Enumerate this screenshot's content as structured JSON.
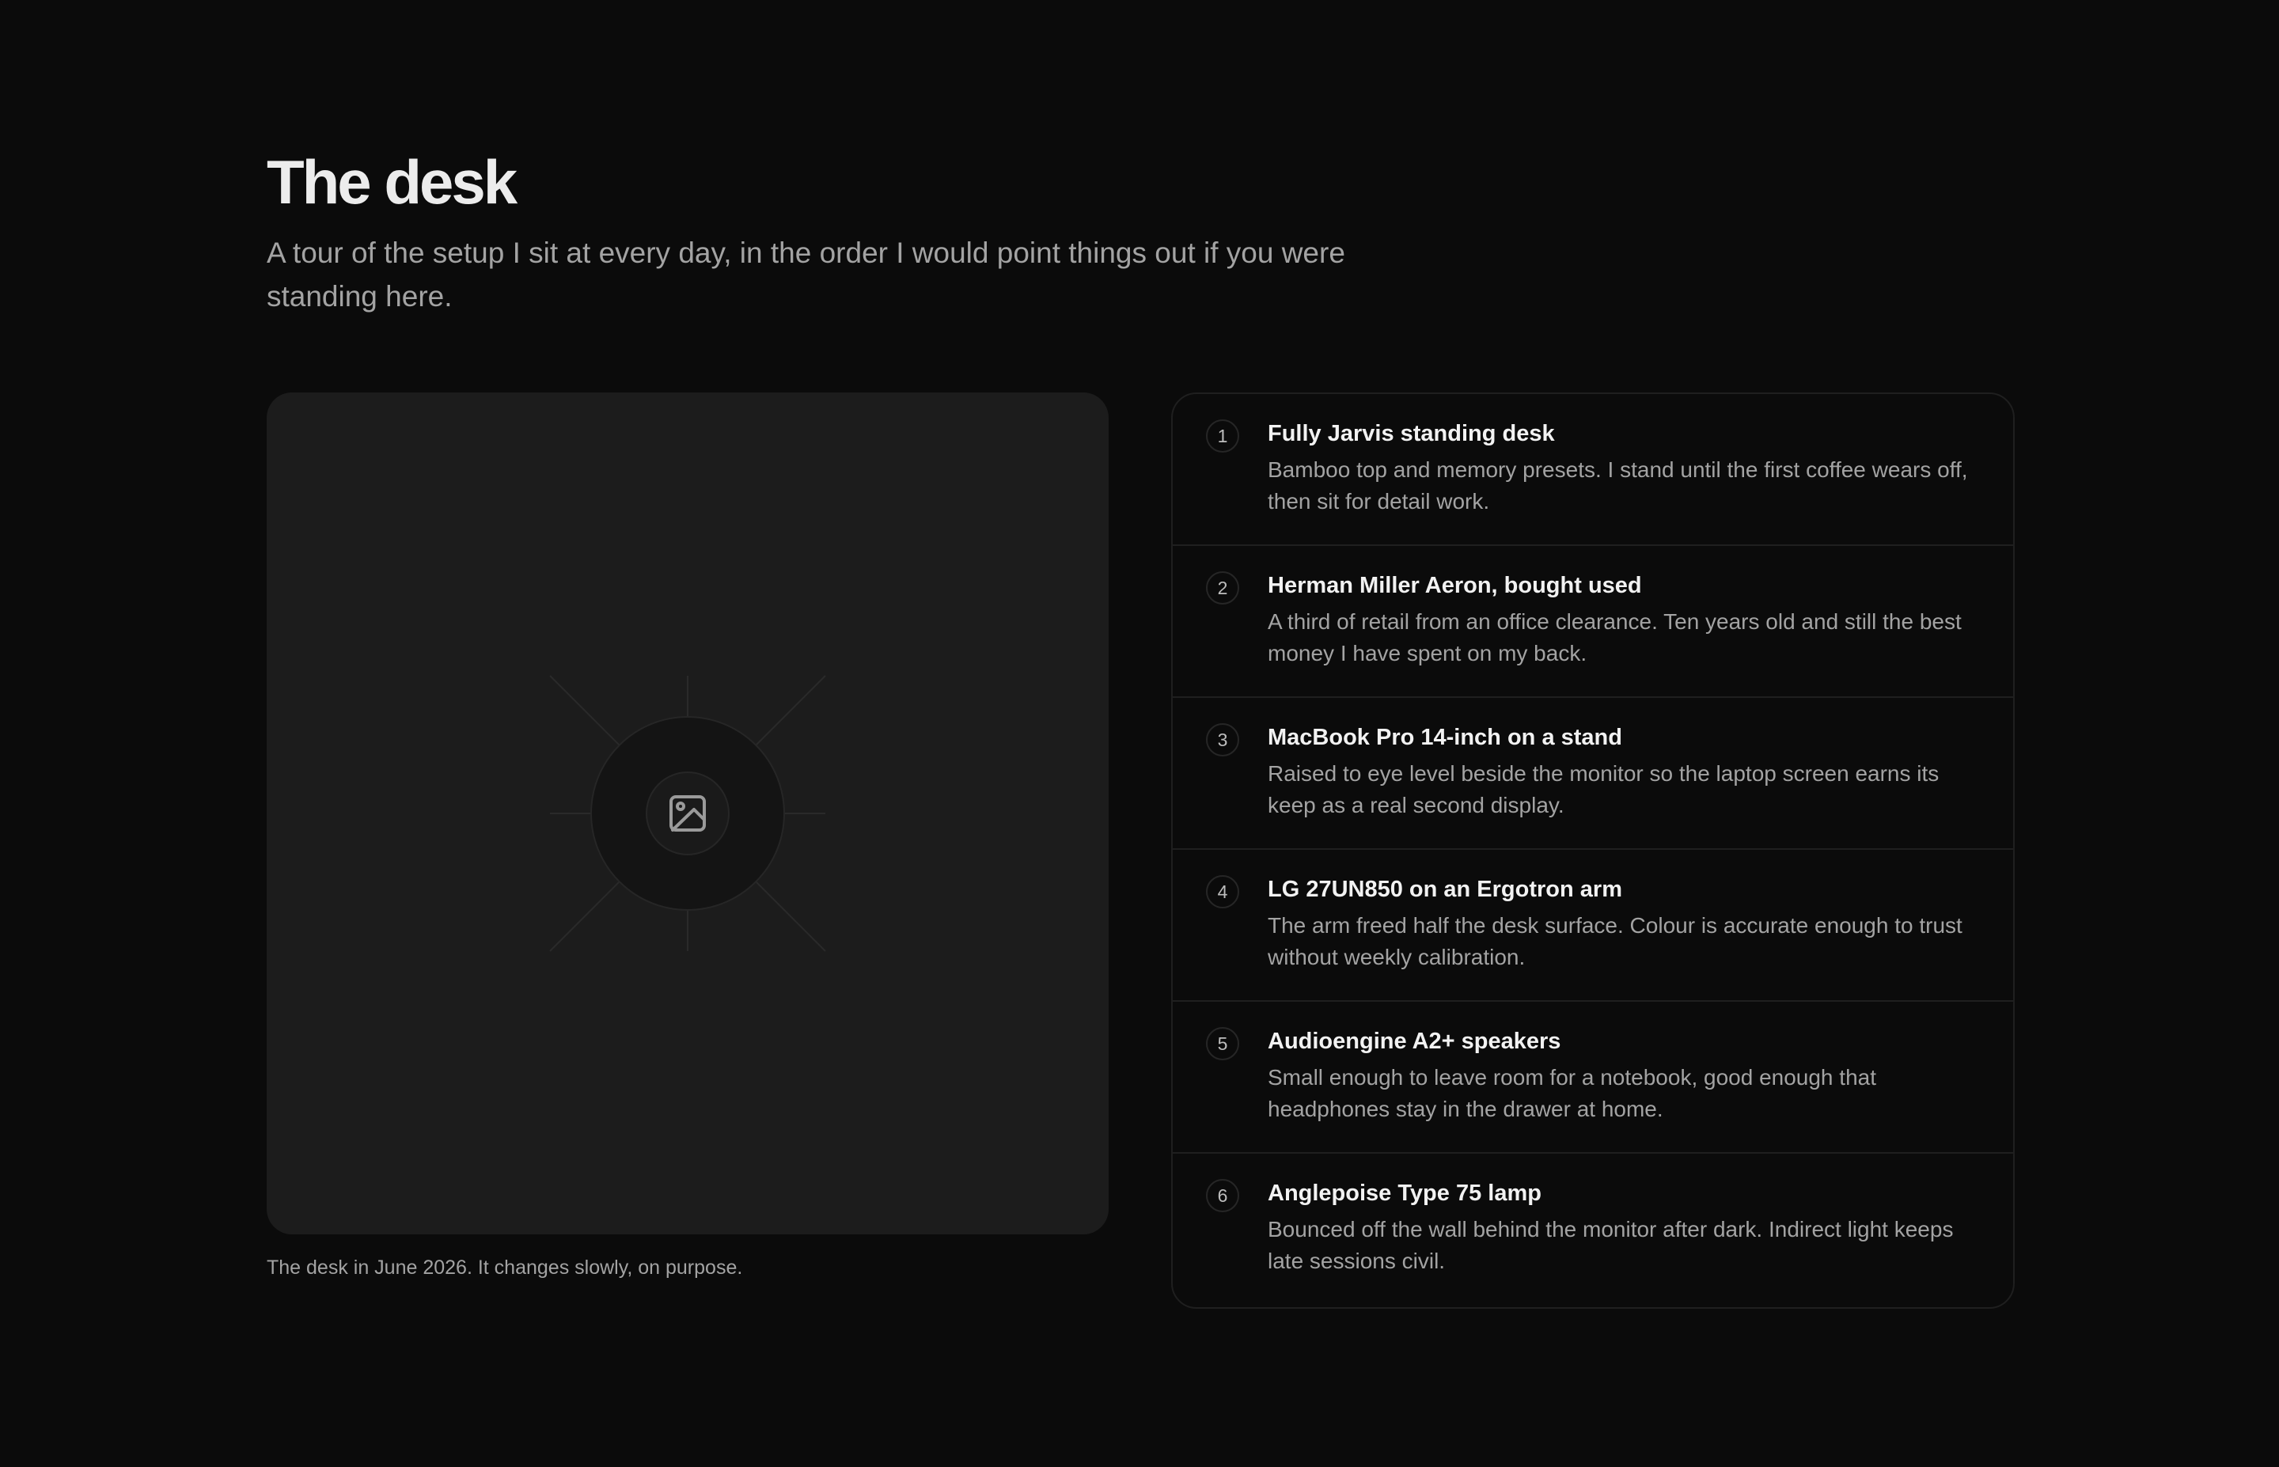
{
  "header": {
    "title": "The desk",
    "subtitle": "A tour of the setup I sit at every day, in the order I would point things out if you were standing here."
  },
  "figure": {
    "image_icon": "image-icon",
    "caption": "The desk in June 2026. It changes slowly, on purpose."
  },
  "items": [
    {
      "number": "1",
      "title": "Fully Jarvis standing desk",
      "description": "Bamboo top and memory presets. I stand until the first coffee wears off, then sit for detail work."
    },
    {
      "number": "2",
      "title": "Herman Miller Aeron, bought used",
      "description": "A third of retail from an office clearance. Ten years old and still the best money I have spent on my back."
    },
    {
      "number": "3",
      "title": "MacBook Pro 14-inch on a stand",
      "description": "Raised to eye level beside the monitor so the laptop screen earns its keep as a real second display."
    },
    {
      "number": "4",
      "title": "LG 27UN850 on an Ergotron arm",
      "description": "The arm freed half the desk surface. Colour is accurate enough to trust without weekly calibration."
    },
    {
      "number": "5",
      "title": "Audioengine A2+ speakers",
      "description": "Small enough to leave room for a notebook, good enough that headphones stay in the drawer at home."
    },
    {
      "number": "6",
      "title": "Anglepoise Type 75 lamp",
      "description": "Bounced off the wall behind the monitor after dark. Indirect light keeps late sessions civil."
    }
  ]
}
